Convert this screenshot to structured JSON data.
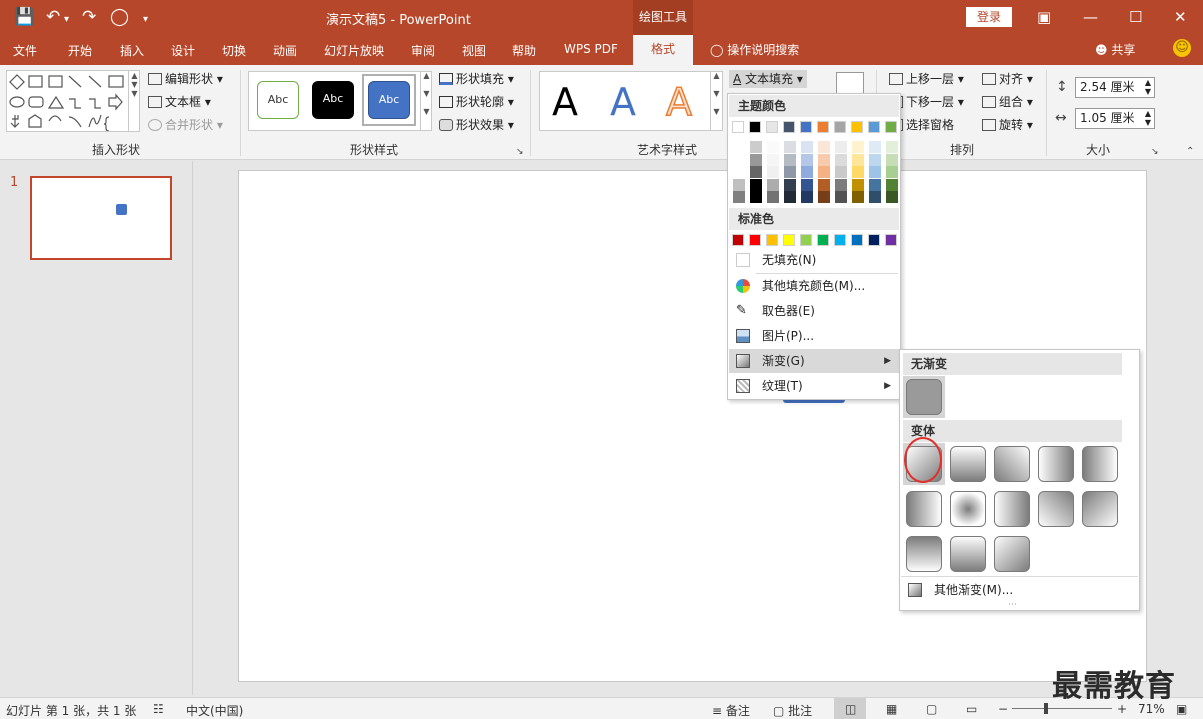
{
  "titlebar": {
    "doc_title": "演示文稿5  -  PowerPoint",
    "context_tab": "绘图工具",
    "login": "登录"
  },
  "tabs": [
    "文件",
    "开始",
    "插入",
    "设计",
    "切换",
    "动画",
    "幻灯片放映",
    "审阅",
    "视图",
    "帮助",
    "WPS PDF"
  ],
  "active_tab": "格式",
  "tell_me": "操作说明搜索",
  "share": "共享",
  "ribbon": {
    "insert_shapes": {
      "label": "插入形状",
      "edit_shape": "编辑形状",
      "text_box": "文本框",
      "merge_shapes": "合并形状"
    },
    "shape_styles": {
      "label": "形状样式",
      "thumb": "Abc",
      "fill": "形状填充",
      "outline": "形状轮廓",
      "effect": "形状效果"
    },
    "wordart": {
      "label": "艺术字样式",
      "glyph": "A",
      "text_fill": "文本填充"
    },
    "arrange": {
      "label": "排列",
      "bring_forward": "上移一层",
      "send_backward": "下移一层",
      "selection_pane": "选择窗格",
      "align": "对齐",
      "group": "组合",
      "rotate": "旋转"
    },
    "size": {
      "label": "大小",
      "height": "2.54 厘米",
      "width": "1.05 厘米"
    }
  },
  "slide_panel": {
    "number": "1"
  },
  "fill_menu": {
    "theme_colors_header": "主题颜色",
    "standard_colors_header": "标准色",
    "theme_colors": [
      "#ffffff",
      "#000000",
      "#e7e6e6",
      "#44546a",
      "#4472c4",
      "#ed7d31",
      "#a5a5a5",
      "#ffc000",
      "#5b9bd5",
      "#70ad47"
    ],
    "standard_colors": [
      "#c00000",
      "#ff0000",
      "#ffc000",
      "#ffff00",
      "#92d050",
      "#00b050",
      "#00b0f0",
      "#0070c0",
      "#002060",
      "#7030a0"
    ],
    "items": {
      "no_fill": "无填充(N)",
      "more_colors": "其他填充颜色(M)...",
      "eyedropper": "取色器(E)",
      "picture": "图片(P)...",
      "gradient": "渐变(G)",
      "texture": "纹理(T)"
    }
  },
  "gradient_menu": {
    "no_gradient_header": "无渐变",
    "variants_header": "变体",
    "more_gradients": "其他渐变(M)..."
  },
  "status": {
    "slide_info": "幻灯片 第 1 张，共 1 张",
    "language": "中文(中国)",
    "notes": "备注",
    "comments": "批注",
    "zoom": "71%"
  },
  "watermark": "最需教育",
  "colors": {
    "accent": "#b7472a",
    "shape_blue": "#4472c4"
  }
}
